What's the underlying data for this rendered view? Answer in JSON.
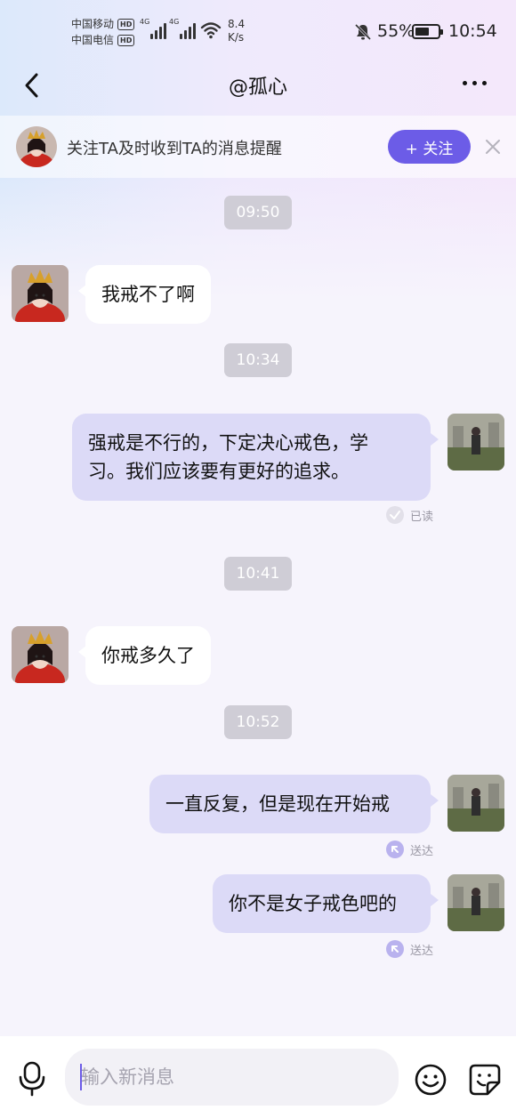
{
  "status_bar": {
    "carrier_1": "中国移动",
    "carrier_2": "中国电信",
    "hd": "HD",
    "network_1": "4G",
    "network_2": "4G",
    "speed_value": "8.4",
    "speed_unit": "K/s",
    "battery": "55%",
    "time": "10:54"
  },
  "header": {
    "title": "@孤心",
    "back_icon": "chevron-left-icon",
    "more_icon": "more-dots-icon"
  },
  "follow_banner": {
    "text": "关注TA及时收到TA的消息提醒",
    "button_label": "+ 关注",
    "accent": "#6c5ce7"
  },
  "messages": [
    {
      "type": "timestamp",
      "text": "09:50"
    },
    {
      "type": "incoming",
      "text": "我戒不了啊"
    },
    {
      "type": "timestamp",
      "text": "10:34"
    },
    {
      "type": "outgoing",
      "lines": [
        "强戒是不行的，下定决心戒色，学",
        "习。我们应该要有更好的追求。"
      ],
      "status": "已读"
    },
    {
      "type": "timestamp",
      "text": "10:41"
    },
    {
      "type": "incoming",
      "text": "你戒多久了"
    },
    {
      "type": "timestamp",
      "text": "10:52"
    },
    {
      "type": "outgoing",
      "text": "一直反复，但是现在开始戒",
      "status": "送达"
    },
    {
      "type": "outgoing",
      "text": "你不是女子戒色吧的",
      "status": "送达"
    }
  ],
  "input_bar": {
    "placeholder": "输入新消息",
    "mic_icon": "microphone-icon",
    "emoji_icon": "emoji-smile-icon",
    "sticker_icon": "sticker-icon"
  }
}
